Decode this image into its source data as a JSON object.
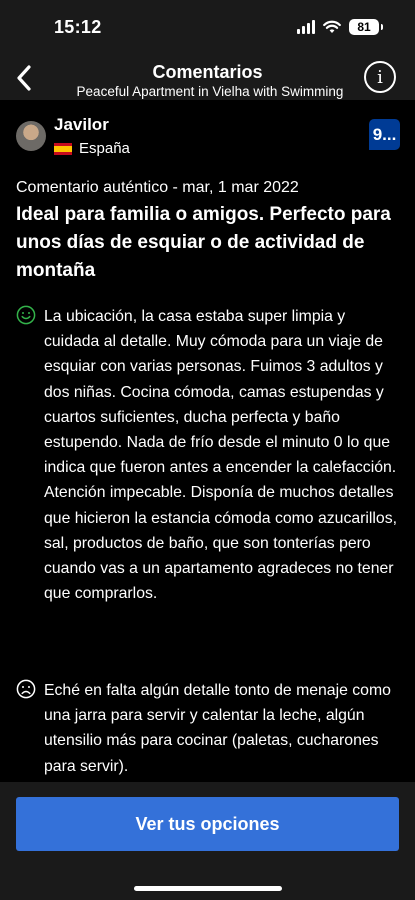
{
  "status_bar": {
    "time": "15:12",
    "battery": "81"
  },
  "header": {
    "title": "Comentarios",
    "subtitle": "Peaceful Apartment in Vielha with Swimming"
  },
  "reviewer": {
    "name": "Javilor",
    "country": "España"
  },
  "score": {
    "label": "9..."
  },
  "review": {
    "meta": "Comentario auténtico - mar, 1 mar 2022",
    "title": "Ideal para familia o amigos. Perfecto para unos días de esquiar o de actividad de montaña",
    "positive": "La ubicación, la casa estaba super limpia y cuidada al detalle. Muy cómoda para un viaje de esquiar con varias personas. Fuimos 3 adultos y dos niñas. Cocina cómoda, camas estupendas y cuartos suficientes, ducha perfecta y baño estupendo. Nada de frío desde el minuto 0 lo que indica que fueron antes a encender la calefacción. Atención impecable. Disponía de muchos detalles que hicieron la estancia cómoda como azucarillos, sal, productos de baño, que son tonterías pero cuando vas a un apartamento agradeces no tener que comprarlos.",
    "negative": "Eché en falta algún detalle tonto de menaje como una jarra para servir y calentar la leche, algún utensilio más para cocinar (paletas, cucharones para servir)."
  },
  "cta": {
    "label": "Ver tus opciones"
  },
  "icons": {
    "back": "chevron-left-icon",
    "info": "info-icon",
    "positive": "smile-icon",
    "negative": "frown-icon",
    "flag": "spain-flag-icon"
  },
  "colors": {
    "background": "#000000",
    "header_bg": "#1a1a1a",
    "accent_blue": "#3471d9",
    "score_blue": "#003b95",
    "positive_green": "#33b24a"
  }
}
